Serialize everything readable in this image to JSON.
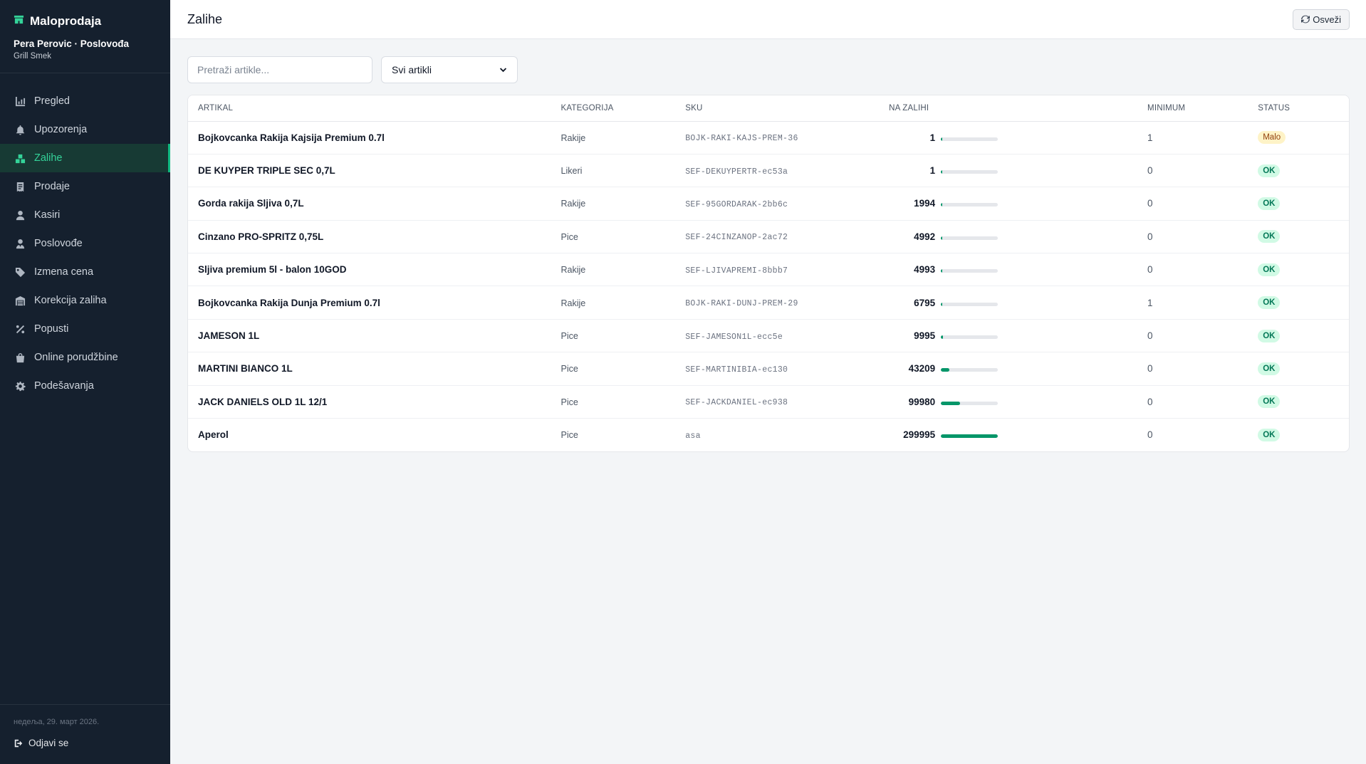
{
  "app": {
    "brand": "Maloprodaja",
    "user": "Pera Perovic · Poslovođa",
    "shop": "Grill Smek"
  },
  "nav": [
    {
      "label": "Pregled",
      "icon": "chart-icon",
      "active": false
    },
    {
      "label": "Upozorenja",
      "icon": "bell-icon",
      "active": false
    },
    {
      "label": "Zalihe",
      "icon": "boxes-icon",
      "active": true
    },
    {
      "label": "Prodaje",
      "icon": "receipt-icon",
      "active": false
    },
    {
      "label": "Kasiri",
      "icon": "user-icon",
      "active": false
    },
    {
      "label": "Poslovođe",
      "icon": "user-tie-icon",
      "active": false
    },
    {
      "label": "Izmena cena",
      "icon": "tag-icon",
      "active": false
    },
    {
      "label": "Korekcija zaliha",
      "icon": "warehouse-icon",
      "active": false
    },
    {
      "label": "Popusti",
      "icon": "percent-icon",
      "active": false
    },
    {
      "label": "Online porudžbine",
      "icon": "shopping-bag-icon",
      "active": false
    },
    {
      "label": "Podešavanja",
      "icon": "gear-icon",
      "active": false
    }
  ],
  "footer": {
    "date": "недеља, 29. март 2026.",
    "logout": "Odjavi se"
  },
  "header": {
    "title": "Zalihe",
    "refresh_label": "Osveži"
  },
  "filters": {
    "search_placeholder": "Pretraži artikle...",
    "search_value": "",
    "select_value": "Svi artikli"
  },
  "table": {
    "columns": [
      "ARTIKAL",
      "KATEGORIJA",
      "SKU",
      "NA ZALIHI",
      "MINIMUM",
      "STATUS"
    ],
    "rows": [
      {
        "name": "Bojkovcanka Rakija Kajsija Premium 0.7l",
        "category": "Rakije",
        "sku": "BOJK-RAKI-KAJS-PREM-36",
        "qty": "1",
        "stock_fraction": 0.0,
        "min": "1",
        "status": "Malo",
        "status_type": "low"
      },
      {
        "name": "DE KUYPER TRIPLE SEC 0,7L",
        "category": "Likeri",
        "sku": "SEF-DEKUYPERTR-ec53a",
        "qty": "1",
        "stock_fraction": 0.0,
        "min": "0",
        "status": "OK",
        "status_type": "ok"
      },
      {
        "name": "Gorda rakija Sljiva 0,7L",
        "category": "Rakije",
        "sku": "SEF-95GORDARAK-2bb6c",
        "qty": "1994",
        "stock_fraction": 0.007,
        "min": "0",
        "status": "OK",
        "status_type": "ok"
      },
      {
        "name": "Cinzano PRO-SPRITZ 0,75L",
        "category": "Pice",
        "sku": "SEF-24CINZANOP-2ac72",
        "qty": "4992",
        "stock_fraction": 0.017,
        "min": "0",
        "status": "OK",
        "status_type": "ok"
      },
      {
        "name": "Sljiva premium 5l - balon 10GOD",
        "category": "Rakije",
        "sku": "SEF-LJIVAPREMI-8bbb7",
        "qty": "4993",
        "stock_fraction": 0.017,
        "min": "0",
        "status": "OK",
        "status_type": "ok"
      },
      {
        "name": "Bojkovcanka Rakija Dunja Premium 0.7l",
        "category": "Rakije",
        "sku": "BOJK-RAKI-DUNJ-PREM-29",
        "qty": "6795",
        "stock_fraction": 0.023,
        "min": "1",
        "status": "OK",
        "status_type": "ok"
      },
      {
        "name": "JAMESON 1L",
        "category": "Pice",
        "sku": "SEF-JAMESON1L-ecc5e",
        "qty": "9995",
        "stock_fraction": 0.033,
        "min": "0",
        "status": "OK",
        "status_type": "ok"
      },
      {
        "name": "MARTINI BIANCO 1L",
        "category": "Pice",
        "sku": "SEF-MARTINIBIA-ec130",
        "qty": "43209",
        "stock_fraction": 0.144,
        "min": "0",
        "status": "OK",
        "status_type": "ok"
      },
      {
        "name": "JACK DANIELS OLD 1L 12/1",
        "category": "Pice",
        "sku": "SEF-JACKDANIEL-ec938",
        "qty": "99980",
        "stock_fraction": 0.333,
        "min": "0",
        "status": "OK",
        "status_type": "ok"
      },
      {
        "name": "Aperol",
        "category": "Pice",
        "sku": "asa",
        "qty": "299995",
        "stock_fraction": 1.0,
        "min": "0",
        "status": "OK",
        "status_type": "ok"
      }
    ]
  },
  "colors": {
    "sidebar_bg": "#15202e",
    "accent": "#10b981",
    "ok_badge_bg": "#d1fae5",
    "low_badge_bg": "#fef3c7",
    "bar_fill": "#059669"
  }
}
